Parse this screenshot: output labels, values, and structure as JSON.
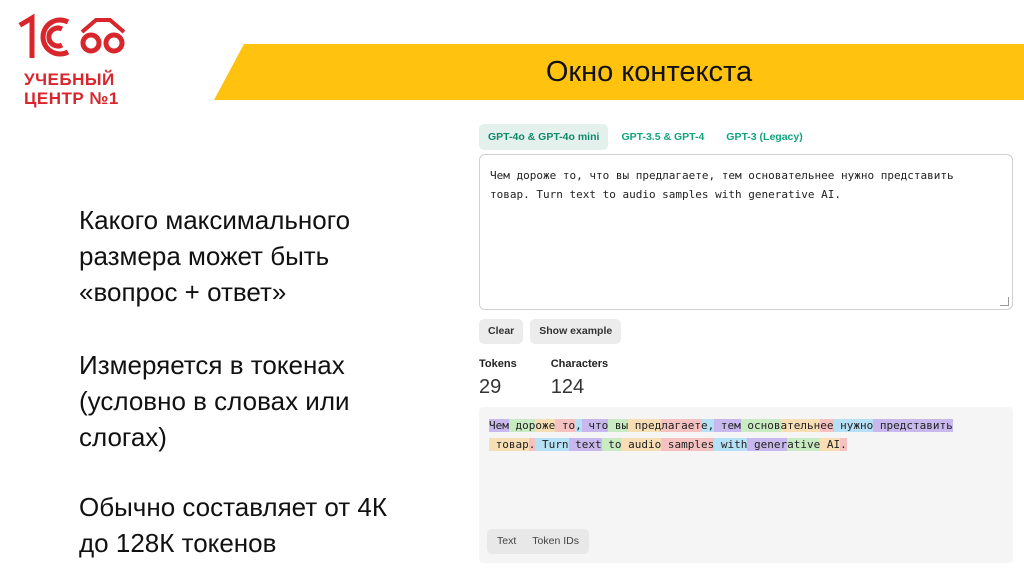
{
  "logo": {
    "line1": "УЧЕБНЫЙ",
    "line2": "ЦЕНТР №1",
    "brand_color": "#d8262c"
  },
  "banner": {
    "title": "Окно контекста",
    "color": "#ffc20e"
  },
  "left_text": {
    "paragraph1": [
      "Какого максимального",
      "размера может быть",
      "«вопрос + ответ»"
    ],
    "paragraph2": [
      "Измеряется в токенах",
      "(условно в словах или",
      "слогах)"
    ],
    "paragraph3": [
      "Обычно составляет от 4К",
      "до 128К токенов"
    ]
  },
  "tokenizer": {
    "tabs": [
      {
        "label": "GPT-4o & GPT-4o mini",
        "active": true
      },
      {
        "label": "GPT-3.5 & GPT-4",
        "active": false
      },
      {
        "label": "GPT-3 (Legacy)",
        "active": false
      }
    ],
    "input_text": "Чем дороже то, что вы предлагаете, тем основательнее нужно представить\nтовар. Turn text to audio samples with generative AI.",
    "buttons": {
      "clear": "Clear",
      "show_example": "Show example"
    },
    "stats": {
      "tokens_label": "Tokens",
      "tokens_value": "29",
      "characters_label": "Characters",
      "characters_value": "124"
    },
    "token_colors": [
      "#c9b8ee",
      "#c8ebc2",
      "#f8deb5",
      "#f6c1c1",
      "#b6e0f5"
    ],
    "tokens": [
      {
        "t": "Чем",
        "c": 0
      },
      {
        "t": " дор",
        "c": 1
      },
      {
        "t": "оже",
        "c": 2
      },
      {
        "t": " то",
        "c": 3
      },
      {
        "t": ",",
        "c": 4
      },
      {
        "t": " что",
        "c": 0
      },
      {
        "t": " вы",
        "c": 1
      },
      {
        "t": " пред",
        "c": 2
      },
      {
        "t": "лагает",
        "c": 3
      },
      {
        "t": "е,",
        "c": 4
      },
      {
        "t": " тем",
        "c": 0
      },
      {
        "t": " основ",
        "c": 1
      },
      {
        "t": "ательн",
        "c": 2
      },
      {
        "t": "ее",
        "c": 3
      },
      {
        "t": " нужно",
        "c": 4
      },
      {
        "t": " представить",
        "c": 0
      },
      {
        "t": "\n",
        "c": -1
      },
      {
        "t": " товар",
        "c": 2
      },
      {
        "t": ".",
        "c": 3
      },
      {
        "t": " Turn",
        "c": 4
      },
      {
        "t": " text",
        "c": 0
      },
      {
        "t": " to",
        "c": 1
      },
      {
        "t": " audio",
        "c": 2
      },
      {
        "t": " samples",
        "c": 3
      },
      {
        "t": " with",
        "c": 4
      },
      {
        "t": " gener",
        "c": 0
      },
      {
        "t": "ative",
        "c": 1
      },
      {
        "t": " AI",
        "c": 2
      },
      {
        "t": ".",
        "c": 3
      }
    ],
    "output_tabs": [
      "Text",
      "Token IDs"
    ]
  }
}
